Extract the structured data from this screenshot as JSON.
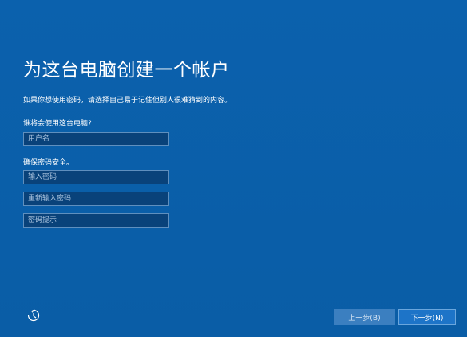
{
  "page": {
    "title": "为这台电脑创建一个帐户",
    "subtitle": "如果你想使用密码，请选择自己易于记住但别人很难猜到的内容。"
  },
  "form": {
    "who_label": "谁将会使用这台电脑?",
    "username_placeholder": "用户名",
    "secure_label": "确保密码安全。",
    "password_placeholder": "输入密码",
    "repassword_placeholder": "重新输入密码",
    "hint_placeholder": "密码提示"
  },
  "footer": {
    "accessibility_icon": "ease-of-access-icon",
    "back_label": "上一步(B)",
    "next_label": "下一步(N)"
  },
  "colors": {
    "background": "#0a5ea8",
    "field_bg": "#09427a",
    "back_button": "#3b7fc0",
    "next_button": "#1d74c8"
  }
}
